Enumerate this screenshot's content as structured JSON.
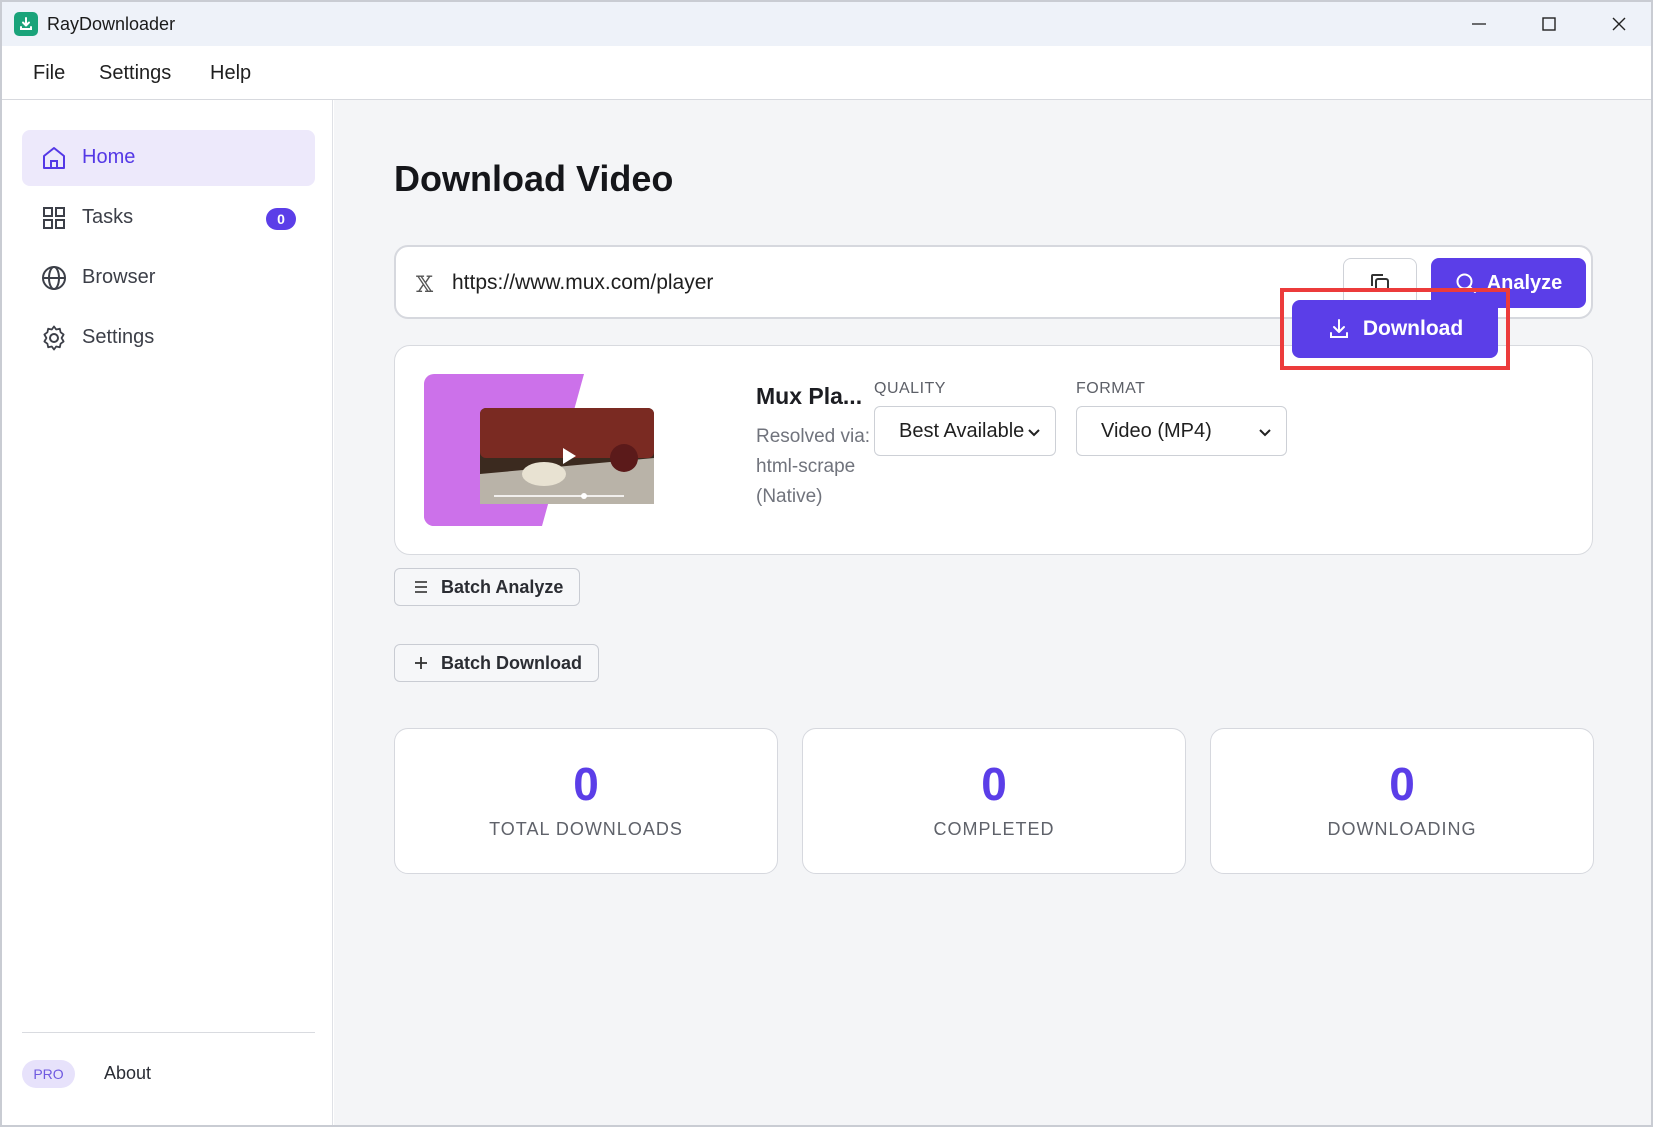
{
  "app": {
    "title": "RayDownloader"
  },
  "menu": {
    "items": [
      "File",
      "Settings",
      "Help"
    ]
  },
  "sidebar": {
    "items": [
      {
        "label": "Home",
        "icon": "home-icon",
        "active": true
      },
      {
        "label": "Tasks",
        "icon": "grid-icon",
        "badge": "0"
      },
      {
        "label": "Browser",
        "icon": "globe-icon"
      },
      {
        "label": "Settings",
        "icon": "gear-icon"
      }
    ],
    "pro_label": "PRO",
    "about_label": "About"
  },
  "main": {
    "page_title": "Download Video",
    "url": {
      "value": "https://www.mux.com/player",
      "source_icon": "x-logo-icon"
    },
    "analyze_label": "Analyze",
    "video": {
      "title": "Mux Pla...",
      "resolved_via": "Resolved via: html-scrape (Native)",
      "quality_label": "QUALITY",
      "quality_value": "Best Available",
      "format_label": "FORMAT",
      "format_value": "Video (MP4)",
      "download_label": "Download"
    },
    "batch_analyze_label": "Batch Analyze",
    "batch_download_label": "Batch Download",
    "stats": [
      {
        "value": "0",
        "label": "TOTAL DOWNLOADS"
      },
      {
        "value": "0",
        "label": "COMPLETED"
      },
      {
        "value": "0",
        "label": "DOWNLOADING"
      }
    ]
  },
  "colors": {
    "accent": "#5b3ee8",
    "highlight": "#ec3b3b",
    "active_nav_bg": "#ede9fb"
  }
}
